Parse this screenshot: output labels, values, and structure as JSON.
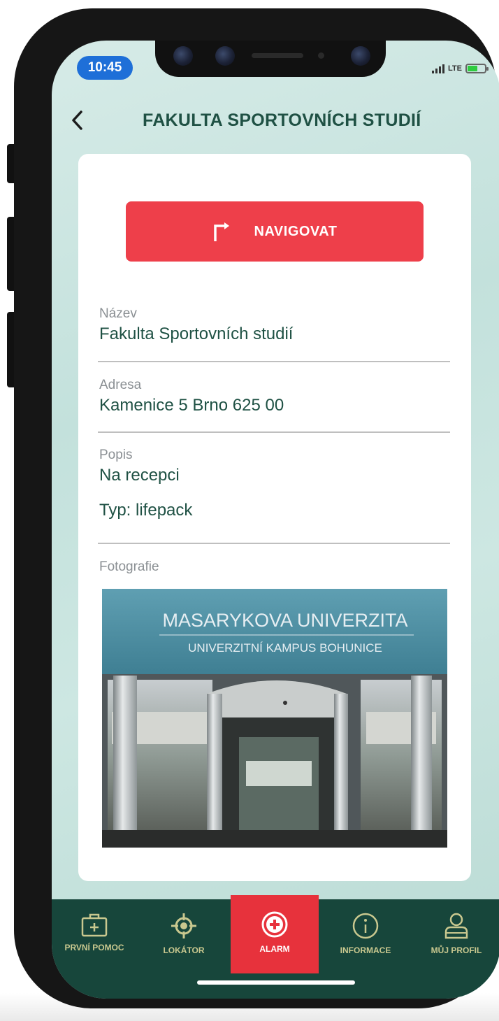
{
  "status_bar": {
    "time": "10:45",
    "network": "LTE"
  },
  "header": {
    "title": "FAKULTA SPORTOVNÍCH STUDIÍ"
  },
  "detail": {
    "navigate_label": "NAVIGOVAT",
    "name_label": "Název",
    "name_value": "Fakulta Sportovních studií",
    "address_label": "Adresa",
    "address_value": "Kamenice 5 Brno 625 00",
    "description_label": "Popis",
    "description_value": "Na recepci",
    "type_value": "Typ: lifepack",
    "photo_label": "Fotografie",
    "photo_sign_line1": "MASARYKOVA UNIVERZITA",
    "photo_sign_line2": "UNIVERZITNÍ KAMPUS BOHUNICE"
  },
  "tabbar": {
    "tabs": [
      {
        "label": "PRVNÍ POMOC",
        "icon": "first-aid-kit-icon"
      },
      {
        "label": "LOKÁTOR",
        "icon": "locator-icon"
      },
      {
        "label": "ALARM",
        "icon": "alarm-plus-icon",
        "active": true
      },
      {
        "label": "INFORMACE",
        "icon": "info-icon"
      },
      {
        "label": "MŮJ PROFIL",
        "icon": "profile-icon"
      }
    ]
  },
  "colors": {
    "accent_red": "#ee3f4a",
    "dark_green": "#17463b",
    "text_green": "#1f5144",
    "tab_label": "#c9c88f"
  }
}
